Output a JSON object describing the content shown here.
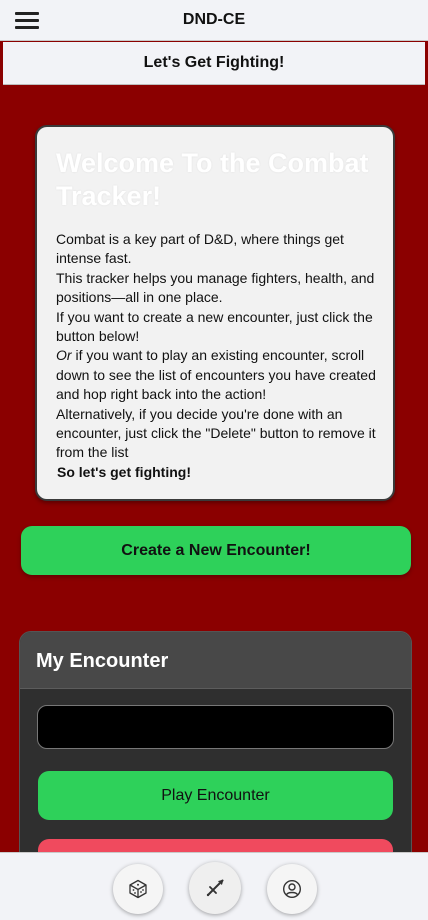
{
  "app": {
    "title": "DND-CE"
  },
  "header": {
    "subtitle": "Let's Get Fighting!"
  },
  "welcome": {
    "title": "Welcome To the Combat Tracker!",
    "p1": "Combat is a key part of D&D, where things get intense fast.",
    "p2": "This tracker helps you manage fighters, health, and positions—all in one place.",
    "p3": "If you want to create a new encounter, just click the button below!",
    "p4_em": "Or",
    "p4_rest": " if you want to play an existing encounter, scroll down to see the list of encounters you have created and hop right back into the action!",
    "p5": "Alternatively, if you decide you're done with an encounter, just click the \"Delete\" button to remove it from the list",
    "cta": "So let's get fighting!"
  },
  "actions": {
    "create_label": "Create a New Encounter!"
  },
  "encounter": {
    "title": "My Encounter",
    "name_value": "",
    "play_label": "Play Encounter",
    "delete_label": ""
  },
  "nav": {
    "items": [
      "dice-icon",
      "sword-icon",
      "user-icon"
    ],
    "active": "sword-icon"
  },
  "colors": {
    "background": "#8b0000",
    "accent_green": "#2ed15a",
    "danger_red": "#f04a5e",
    "card_dark": "#2f2f2f",
    "bar": "#f2f3f7"
  }
}
